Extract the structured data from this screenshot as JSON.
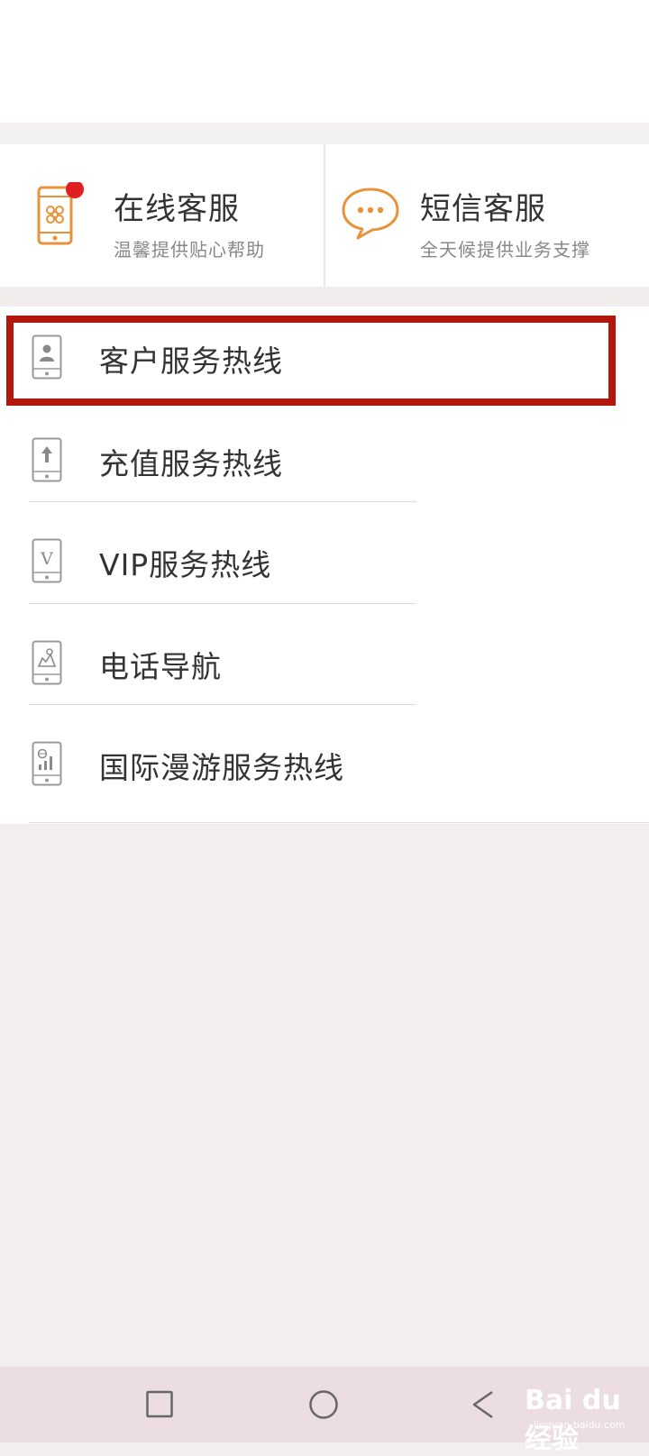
{
  "service_cards": [
    {
      "title": "在线客服",
      "subtitle": "温馨提供贴心帮助",
      "icon": "phone-china-unicom-icon",
      "badge_color": "#e02020"
    },
    {
      "title": "短信客服",
      "subtitle": "全天候提供业务支撑",
      "icon": "chat-bubble-icon"
    }
  ],
  "hotlines": [
    {
      "label": "客户服务热线",
      "icon": "phone-person-icon",
      "highlighted": true
    },
    {
      "label": "充值服务热线",
      "icon": "phone-upload-icon"
    },
    {
      "label": "VIP服务热线",
      "icon": "phone-vip-icon"
    },
    {
      "label": "电话导航",
      "icon": "phone-navigation-icon"
    },
    {
      "label": "国际漫游服务热线",
      "icon": "phone-roaming-icon"
    }
  ],
  "colors": {
    "accent_orange": "#e8923a",
    "highlight_red": "#b3170c",
    "text": "#333333",
    "subtext": "#888888"
  },
  "navigation": {
    "buttons": [
      "recent-apps",
      "home",
      "back"
    ]
  },
  "watermark": {
    "main": "Bai du 经验",
    "sub": "jingyan.baidu.com"
  }
}
